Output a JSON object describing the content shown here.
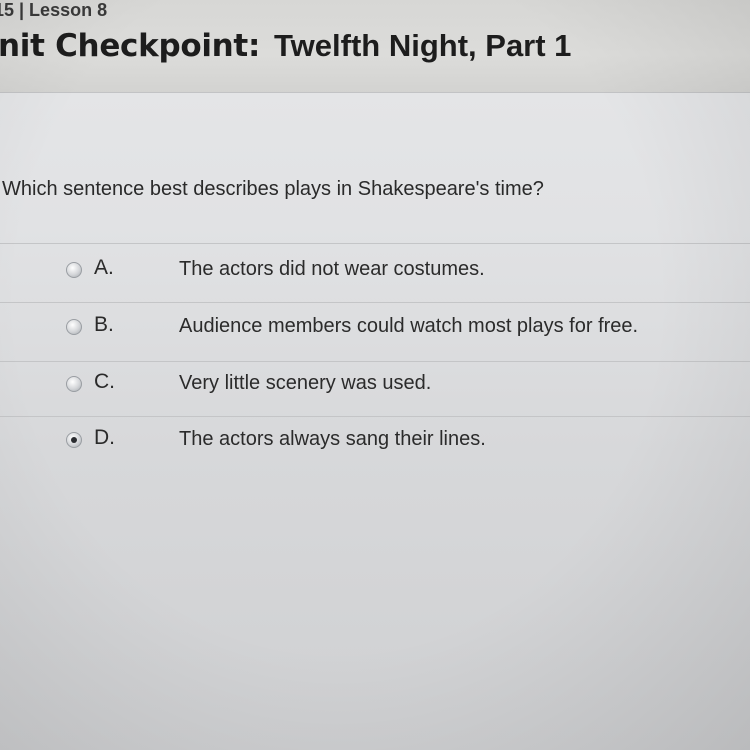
{
  "header": {
    "breadcrumb": "15 | Lesson 8",
    "title_part1": "nit Checkpoint:",
    "title_part2": "Twelfth Night, Part 1"
  },
  "question": {
    "prompt": "Which sentence best describes plays in Shakespeare's time?"
  },
  "choices": [
    {
      "letter": "A.",
      "text": "The actors did not wear costumes.",
      "selected": false
    },
    {
      "letter": "B.",
      "text": "Audience members could watch most plays for free.",
      "selected": false
    },
    {
      "letter": "C.",
      "text": "Very little scenery was used.",
      "selected": false
    },
    {
      "letter": "D.",
      "text": "The actors always sang their lines.",
      "selected": true
    }
  ]
}
